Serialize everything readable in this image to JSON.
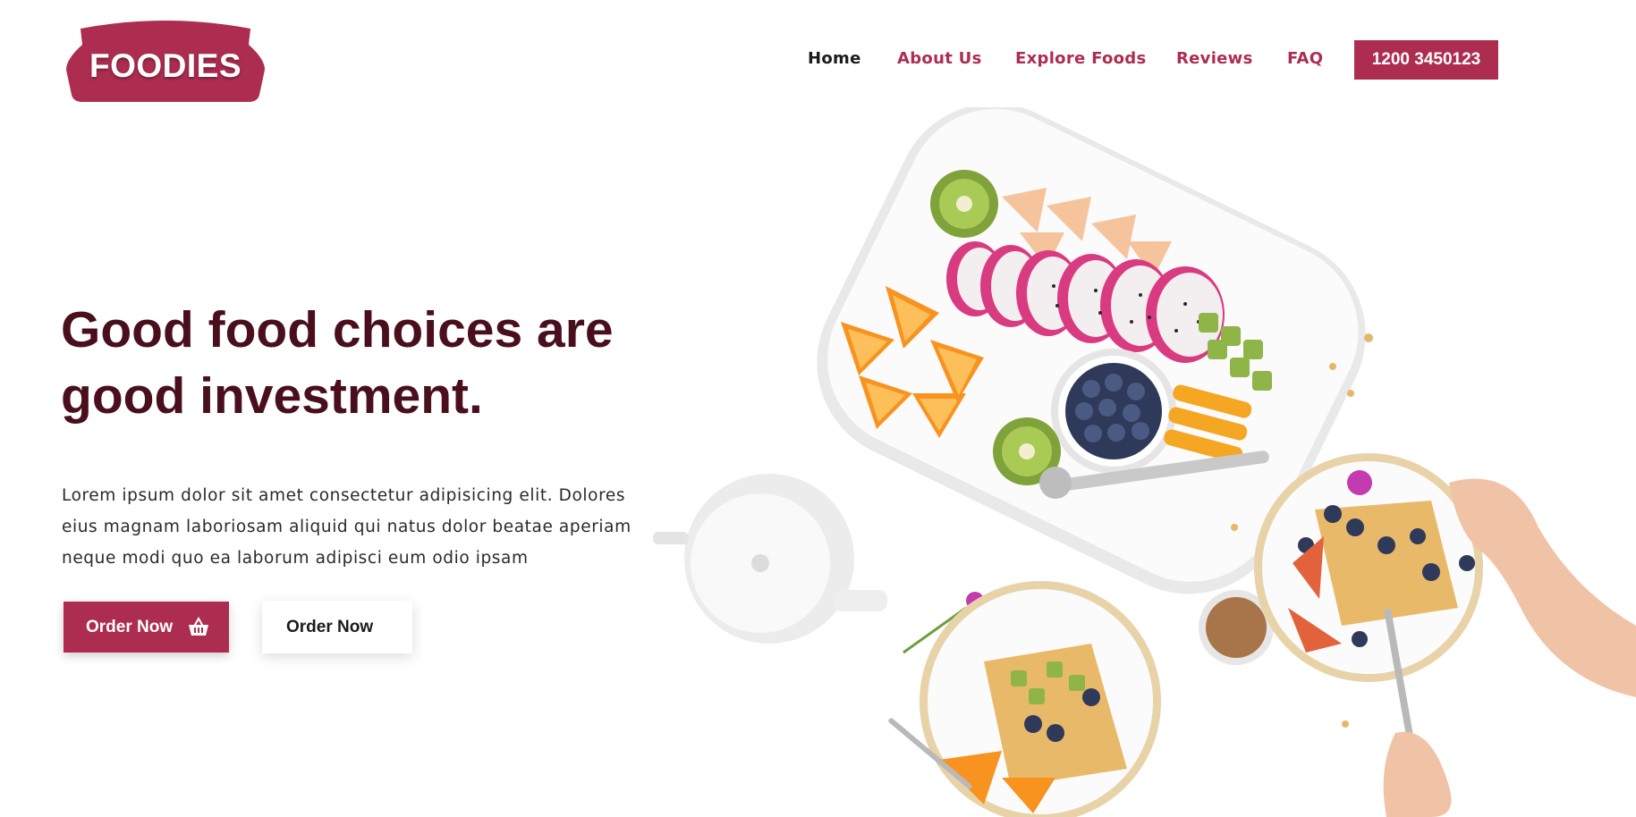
{
  "brand": {
    "logo_text": "FOODIES",
    "color": "#ad2d50"
  },
  "nav": {
    "items": [
      {
        "label": "Home",
        "active": true
      },
      {
        "label": "About Us",
        "active": false
      },
      {
        "label": "Explore Foods",
        "active": false
      },
      {
        "label": "Reviews",
        "active": false
      },
      {
        "label": "FAQ",
        "active": false
      }
    ],
    "phone": "1200 3450123"
  },
  "hero": {
    "title_lines": [
      "Good food choices are",
      "good investment."
    ],
    "description_lines": [
      "Lorem ipsum dolor sit amet consectetur adipisicing elit. Dolores",
      "eius magnam laboriosam aliquid qui natus dolor beatae aperiam",
      "neque modi quo ea laborum adipisci eum odio ipsam"
    ],
    "primary_button": {
      "label": "Order Now",
      "icon": "basket-icon"
    },
    "secondary_button": {
      "label": "Order Now"
    },
    "image_subject": "food-platter-photo"
  },
  "colors": {
    "accent": "#ad2d50",
    "heading": "#4a0f1c",
    "nav_active": "#1b1b1b"
  }
}
